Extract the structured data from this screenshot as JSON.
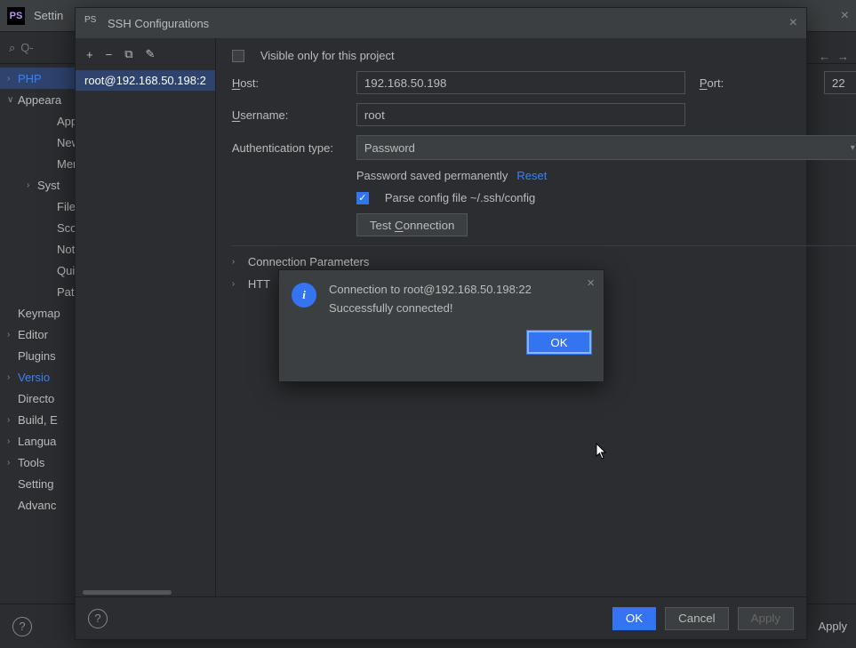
{
  "app": {
    "logo_text": "PS",
    "settings_label": "Settin",
    "search_placeholder": "Q-",
    "nav_back": "←",
    "nav_fwd": "→"
  },
  "tree": {
    "items": [
      {
        "label": "PHP",
        "chev": "›",
        "level": 1,
        "modified": true,
        "selected": true
      },
      {
        "label": "Appeara",
        "chev": "∨",
        "level": 1
      },
      {
        "label": "Appe",
        "level": 3
      },
      {
        "label": "New",
        "level": 3
      },
      {
        "label": "Men",
        "level": 3
      },
      {
        "label": "Syst",
        "chev": "›",
        "level": 2
      },
      {
        "label": "File",
        "level": 3
      },
      {
        "label": "Scop",
        "level": 3
      },
      {
        "label": "Notif",
        "level": 3
      },
      {
        "label": "Quic",
        "level": 3
      },
      {
        "label": "Path",
        "level": 3
      },
      {
        "label": "Keymap",
        "level": 1
      },
      {
        "label": "Editor",
        "chev": "›",
        "level": 1
      },
      {
        "label": "Plugins",
        "level": 1
      },
      {
        "label": "Versio",
        "chev": "›",
        "level": 1,
        "modified": true
      },
      {
        "label": "Directo",
        "level": 1
      },
      {
        "label": "Build, E",
        "chev": "›",
        "level": 1
      },
      {
        "label": "Langua",
        "chev": "›",
        "level": 1
      },
      {
        "label": "Tools",
        "chev": "›",
        "level": 1
      },
      {
        "label": "Setting",
        "level": 1
      },
      {
        "label": "Advanc",
        "level": 1
      }
    ]
  },
  "bg_footer": {
    "apply": "Apply"
  },
  "ssh": {
    "title": "SSH Configurations",
    "toolbar": {
      "add": "+",
      "remove": "−",
      "copy": "⧉",
      "edit": "✎"
    },
    "list": {
      "item0": "root@192.168.50.198:2"
    },
    "visible_only": "Visible only for this project",
    "host_label": "Host:",
    "host_value": "192.168.50.198",
    "host_u": "H",
    "port_label": "Port:",
    "port_u": "P",
    "port_value": "22",
    "user_label": "Username:",
    "user_u": "U",
    "user_value": "root",
    "auth_label": "Authentication type:",
    "auth_value": "Password",
    "saved_text": "Password saved permanently",
    "reset": "Reset",
    "parse_config": "Parse config file ~/.ssh/config",
    "test_btn": "Test Connection",
    "test_u": "C",
    "section1": "Connection Parameters",
    "section2": "HTT",
    "footer_ok": "OK",
    "footer_cancel": "Cancel",
    "footer_apply": "Apply"
  },
  "popup": {
    "line1": "Connection to root@192.168.50.198:22",
    "line2": "Successfully connected!",
    "ok": "OK",
    "info": "i"
  }
}
